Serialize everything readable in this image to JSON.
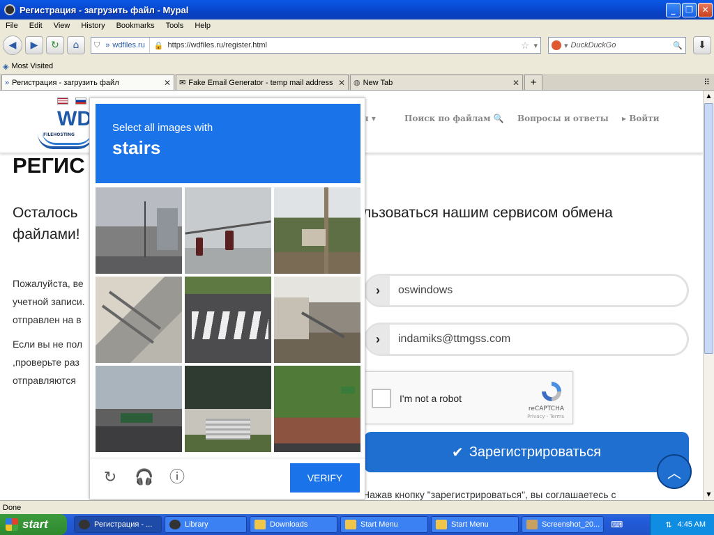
{
  "window": {
    "title": "Регистрация - загрузить файл - Mypal"
  },
  "menu": [
    "File",
    "Edit",
    "View",
    "History",
    "Bookmarks",
    "Tools",
    "Help"
  ],
  "nav": {
    "site_label": "wdfiles.ru",
    "url": "https://wdfiles.ru/register.html",
    "search_placeholder": "DuckDuckGo"
  },
  "bookmarks": {
    "most_visited": "Most Visited"
  },
  "tabs": [
    {
      "label": "Регистрация - загрузить файл",
      "active": true
    },
    {
      "label": "Fake Email Generator - temp mail address",
      "active": false
    },
    {
      "label": "New Tab",
      "active": false
    }
  ],
  "site": {
    "logo_text": "WD",
    "logo_sub": "FILEHOSTING",
    "nav_items": [
      "ая ▾",
      "Поиск по файлам",
      "Вопросы и ответы",
      "▸ Войти"
    ],
    "heading": "РЕГИС",
    "lead_left_1": "Осталось",
    "lead_right_1": "льзоваться нашим сервисом обмена",
    "lead_left_2": "файлами!",
    "para1": [
      "Пожалуйста, ве",
      "учетной записи.",
      "отправлен на в"
    ],
    "para2": [
      "Если вы не пол",
      ",проверьте раз",
      "отправляются"
    ]
  },
  "form": {
    "username": "oswindows",
    "email": "indamiks@ttmgss.com",
    "recaptcha_label": "I'm not a robot",
    "recaptcha_brand": "reCAPTCHA",
    "recaptcha_links": "Privacy - Terms",
    "register_button": "Зарегистрироваться",
    "agree_text": "Нажав кнопку \"зарегистрироваться\", вы соглашаетесь с"
  },
  "challenge": {
    "prompt_small": "Select all images with",
    "prompt_big": "stairs",
    "verify_label": "VERIFY",
    "tiles": [
      {
        "desc": "street-with-poles"
      },
      {
        "desc": "traffic-lights"
      },
      {
        "desc": "palm-trees"
      },
      {
        "desc": "stairs"
      },
      {
        "desc": "crosswalk"
      },
      {
        "desc": "stairs"
      },
      {
        "desc": "overpass-road"
      },
      {
        "desc": "porch-steps"
      },
      {
        "desc": "trees-sign"
      }
    ]
  },
  "status": {
    "text": "Done"
  },
  "taskbar": {
    "start": "start",
    "items": [
      "Регистрация - ...",
      "Library",
      "Downloads",
      "Start Menu",
      "Start Menu",
      "Screenshot_20..."
    ],
    "clock": "4:45 AM"
  },
  "colors": {
    "accent": "#1a73e8",
    "button": "#1f6fd1"
  }
}
